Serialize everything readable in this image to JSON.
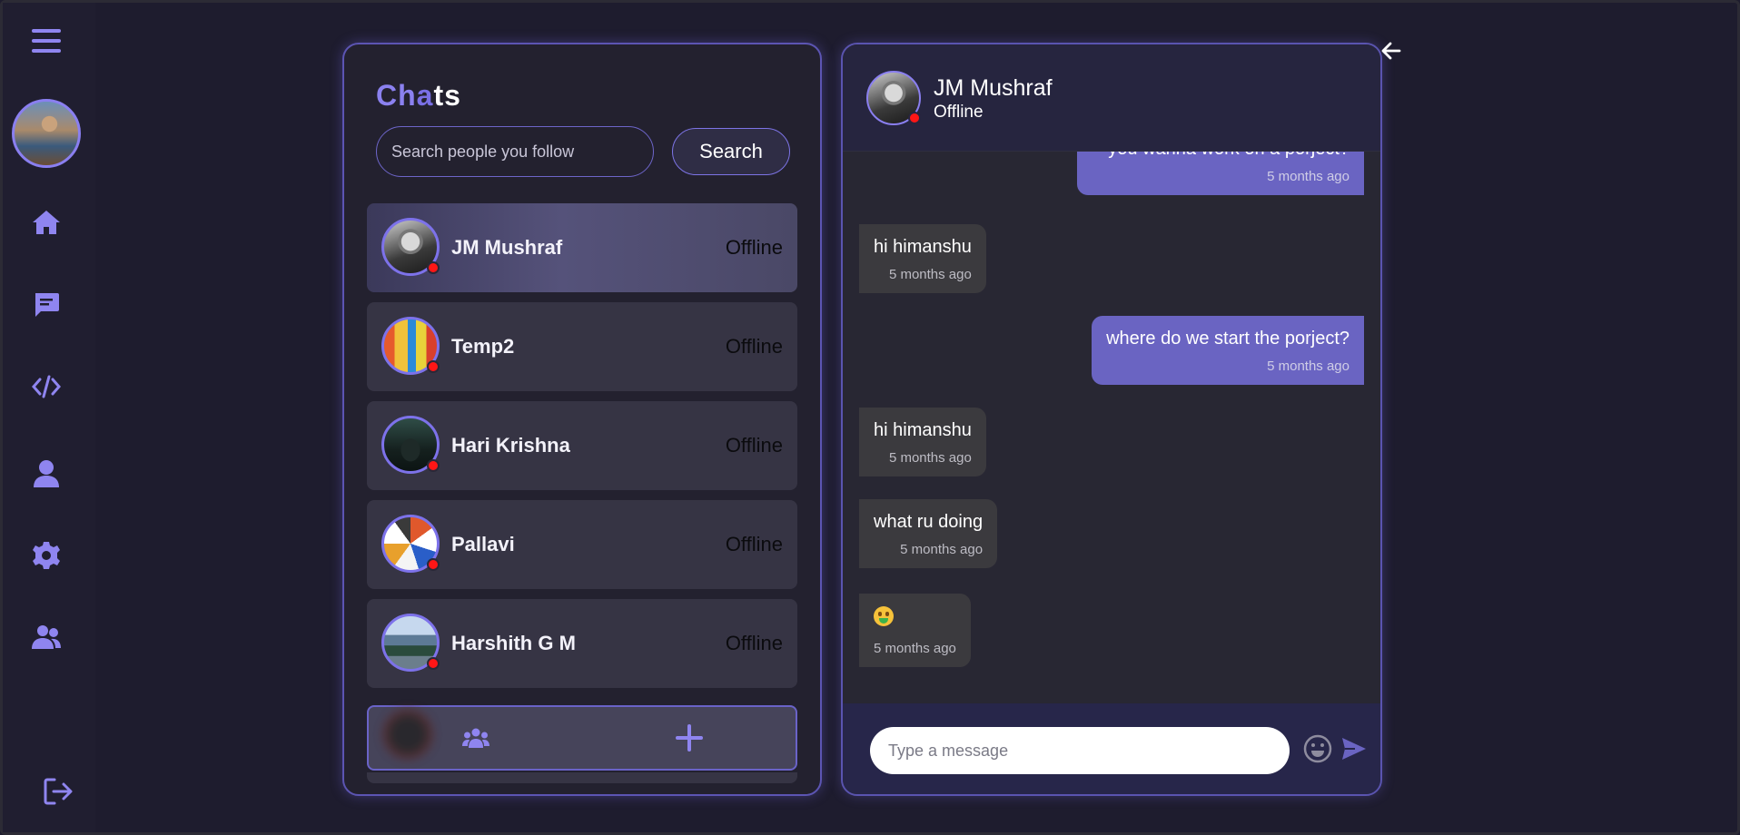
{
  "chats": {
    "title_parts": [
      "Ch",
      "a",
      "ts"
    ],
    "search_placeholder": "Search people you follow",
    "search_button": "Search",
    "items": [
      {
        "name": "JM Mushraf",
        "status": "Offline",
        "avatar": "bw-portrait"
      },
      {
        "name": "Temp2",
        "status": "Offline",
        "avatar": "colorful-figure"
      },
      {
        "name": "Hari Krishna",
        "status": "Offline",
        "avatar": "dark-forest"
      },
      {
        "name": "Pallavi",
        "status": "Offline",
        "avatar": "butterfly-collage"
      },
      {
        "name": "Harshith G M",
        "status": "Offline",
        "avatar": "lake-landscape"
      }
    ]
  },
  "conversation": {
    "name": "JM Mushraf",
    "status": "Offline",
    "messages": [
      {
        "dir": "out",
        "text": "you wanna work on a porject?",
        "time": "5 months ago"
      },
      {
        "dir": "in",
        "text": "hi himanshu",
        "time": "5 months ago"
      },
      {
        "dir": "out",
        "text": "where do we start the porject?",
        "time": "5 months ago"
      },
      {
        "dir": "in",
        "text": "hi himanshu",
        "time": "5 months ago"
      },
      {
        "dir": "in",
        "text": "what ru doing",
        "time": "5 months ago"
      },
      {
        "dir": "in",
        "text": "money-mouth-face-emoji",
        "time": "5 months ago"
      }
    ],
    "input_placeholder": "Type a message"
  },
  "sidebar": {
    "icons": [
      "menu-icon",
      "home-icon",
      "chat-icon",
      "code-icon",
      "user-icon",
      "settings-icon",
      "users-icon",
      "logout-icon"
    ]
  },
  "colors": {
    "accent": "#8f85f0",
    "outgoing_bubble": "#6a64c2",
    "incoming_bubble": "#3b3a3e",
    "offline_dot": "#ff1616"
  }
}
